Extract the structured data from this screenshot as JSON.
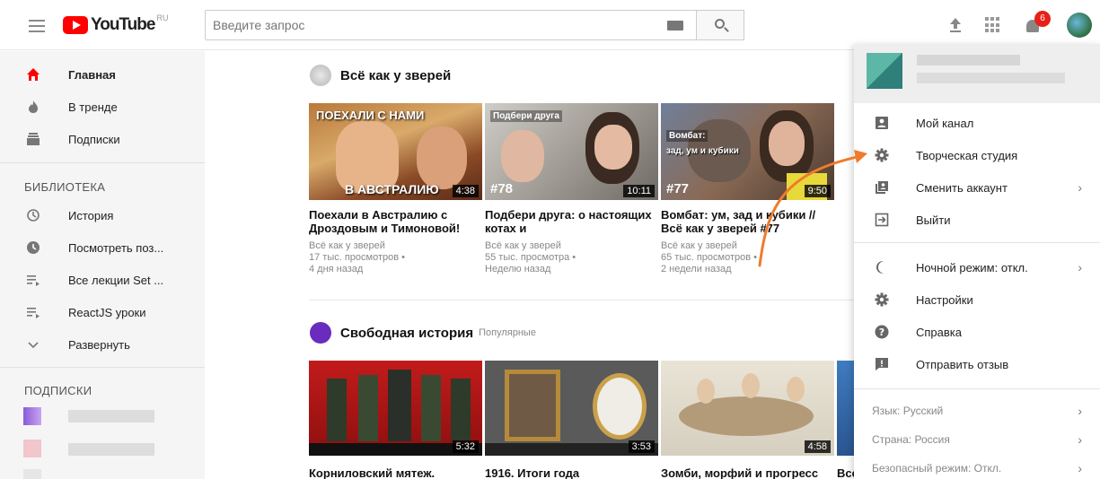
{
  "header": {
    "logo_text": "YouTube",
    "logo_region": "RU",
    "search_placeholder": "Введите запрос",
    "notification_count": "6"
  },
  "sidebar": {
    "main": [
      {
        "label": "Главная",
        "icon": "home-icon",
        "active": true
      },
      {
        "label": "В тренде",
        "icon": "fire-icon"
      },
      {
        "label": "Подписки",
        "icon": "subscriptions-icon"
      }
    ],
    "library_header": "БИБЛИОТЕКА",
    "library": [
      {
        "label": "История",
        "icon": "history-icon"
      },
      {
        "label": "Посмотреть поз...",
        "icon": "clock-icon"
      },
      {
        "label": "Все лекции Set ...",
        "icon": "playlist-icon"
      },
      {
        "label": "ReactJS уроки",
        "icon": "playlist-icon"
      },
      {
        "label": "Развернуть",
        "icon": "chevron-down-icon"
      }
    ],
    "subscriptions_header": "ПОДПИСКИ"
  },
  "shelves": [
    {
      "title": "Всё как у зверей",
      "subtitle": "",
      "videos": [
        {
          "title": "Поехали в Австралию с Дроздовым и Тимоновой!",
          "channel": "Всё как у зверей",
          "views": "17 тыс. просмотров •",
          "age": "4 дня назад",
          "duration": "4:38",
          "overlay_top": "ПОЕХАЛИ С НАМИ",
          "overlay_bottom": "В АВСТРАЛИЮ"
        },
        {
          "title": "Подбери друга: о настоящих котах и",
          "channel": "Всё как у зверей",
          "views": "55 тыс. просмотра •",
          "age": "Неделю назад",
          "duration": "10:11",
          "overlay_top": "Подбери друга",
          "overlay_bottom": "#78"
        },
        {
          "title": "Вомбат: ум, зад и кубики // Всё как у зверей #77",
          "channel": "Всё как у зверей",
          "views": "65 тыс. просмотров •",
          "age": "2 недели назад",
          "duration": "9:50",
          "overlay_top": "Вомбат:",
          "overlay_mid": "зад, ум и кубики",
          "overlay_bottom": "#77"
        }
      ]
    },
    {
      "title": "Свободная история",
      "subtitle": "Популярные",
      "videos": [
        {
          "title": "Корниловский мятеж.",
          "duration": "5:32"
        },
        {
          "title": "1916. Итоги года",
          "duration": "3:53"
        },
        {
          "title": "Зомби, морфий и прогресс",
          "duration": "4:58"
        },
        {
          "title": "Все"
        }
      ]
    }
  ],
  "account_menu": {
    "items": [
      {
        "label": "Мой канал",
        "icon": "account-box-icon"
      },
      {
        "label": "Творческая студия",
        "icon": "gear-icon"
      },
      {
        "label": "Сменить аккаунт",
        "icon": "switch-account-icon",
        "chevron": "›"
      },
      {
        "label": "Выйти",
        "icon": "exit-icon"
      },
      {
        "label": "Ночной режим: откл.",
        "icon": "moon-icon",
        "chevron": "›"
      },
      {
        "label": "Настройки",
        "icon": "gear-icon"
      },
      {
        "label": "Справка",
        "icon": "help-icon"
      },
      {
        "label": "Отправить отзыв",
        "icon": "feedback-icon"
      }
    ],
    "footer": [
      {
        "label": "Язык: Русский",
        "chevron": "›"
      },
      {
        "label": "Страна: Россия",
        "chevron": "›"
      },
      {
        "label": "Безопасный режим: Откл.",
        "chevron": "›"
      }
    ]
  },
  "colors": {
    "youtube_red": "#ff0000",
    "annotation_arrow": "#f07b2d",
    "badge": "#e62117"
  }
}
